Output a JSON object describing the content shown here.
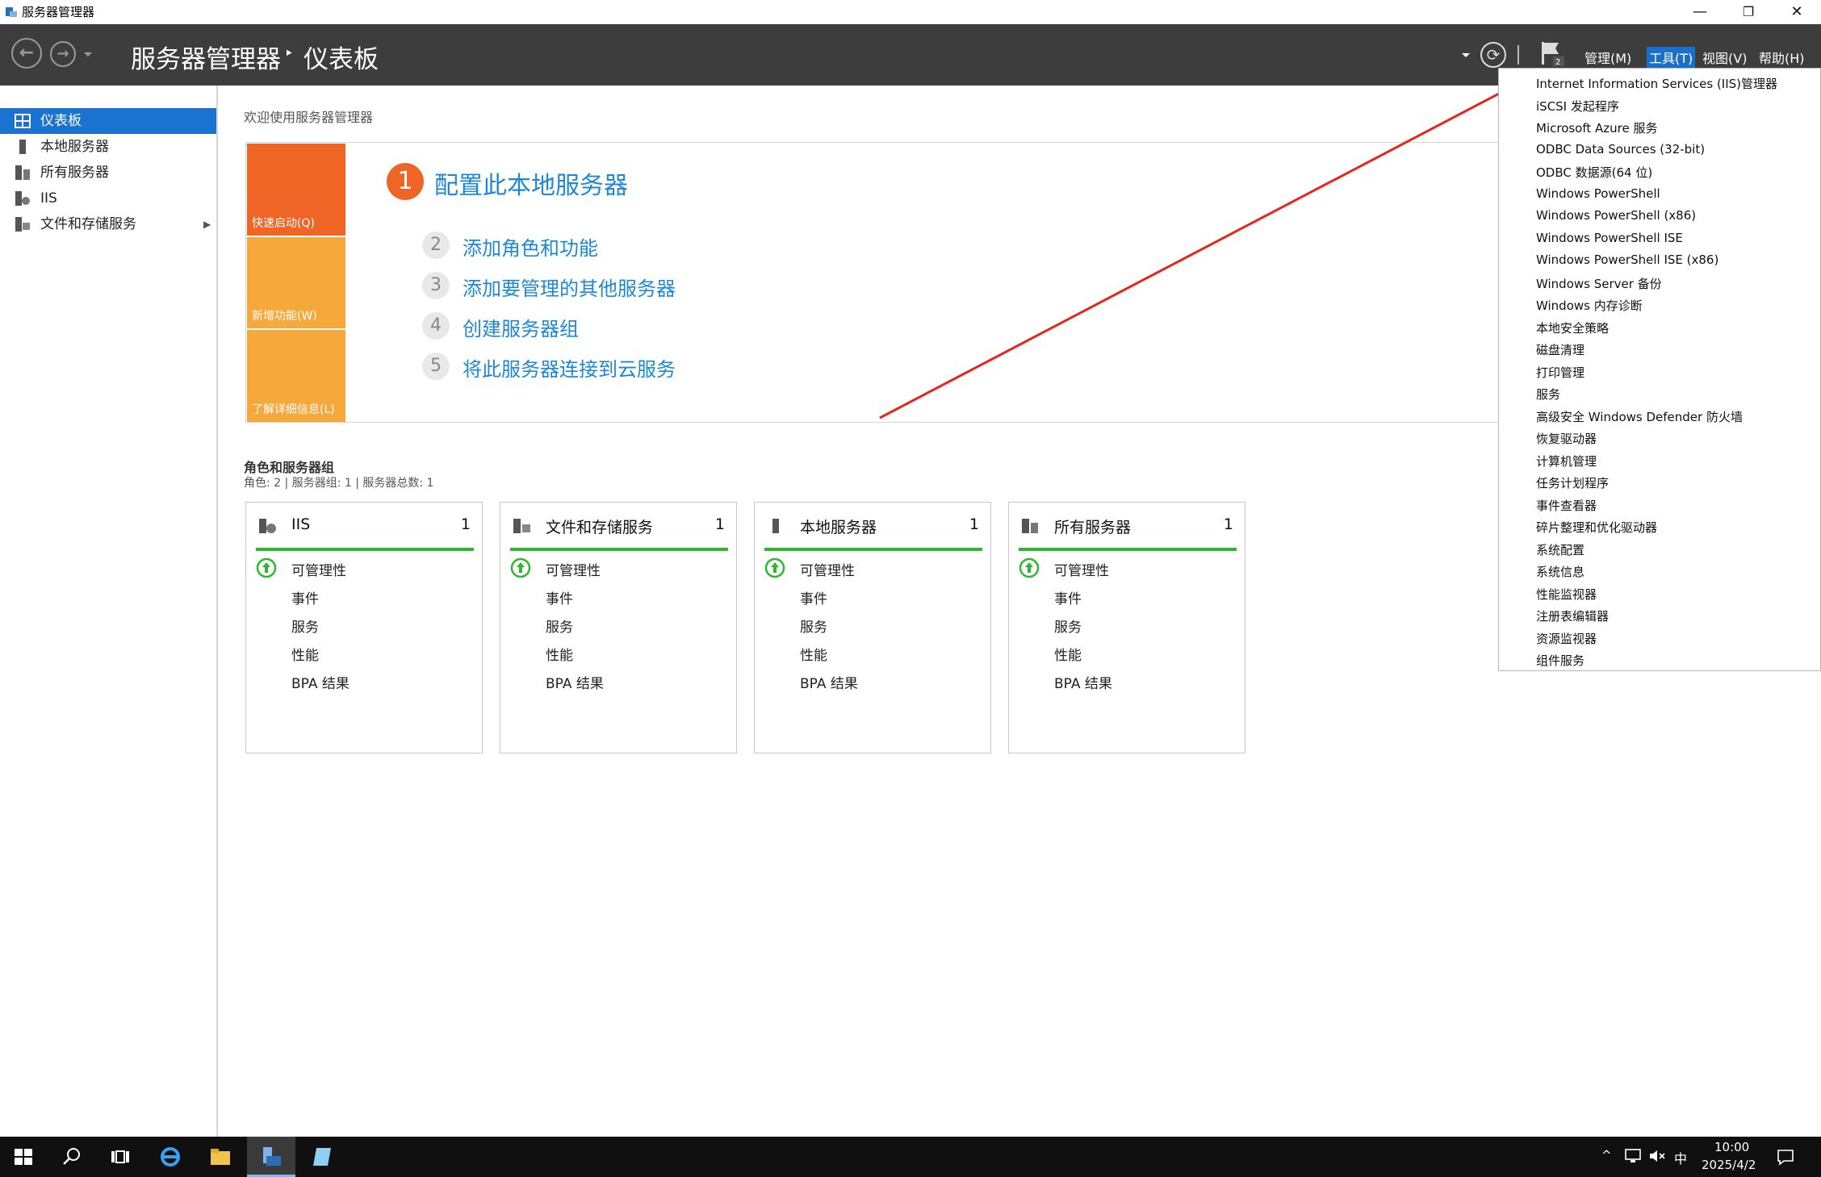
{
  "window": {
    "title": "服务器管理器",
    "controls": {
      "minimize": "—",
      "maximize": "❐",
      "close": "✕"
    }
  },
  "header": {
    "breadcrumb_root": "服务器管理器",
    "breadcrumb_sep": "‣",
    "breadcrumb_page": "仪表板",
    "back_icon": "←",
    "forward_icon": "→",
    "refresh_icon": "⟳",
    "menus": {
      "manage": "管理(M)",
      "tools": "工具(T)",
      "view": "视图(V)",
      "help": "帮助(H)"
    }
  },
  "sidebar": {
    "items": [
      {
        "label": "仪表板"
      },
      {
        "label": "本地服务器"
      },
      {
        "label": "所有服务器"
      },
      {
        "label": "IIS"
      },
      {
        "label": "文件和存储服务"
      }
    ],
    "expand_icon": "▶"
  },
  "main": {
    "welcome_title": "欢迎使用服务器管理器",
    "quickstart": {
      "tiles": [
        "快速启动(Q)",
        "新增功能(W)",
        "了解详细信息(L)"
      ],
      "steps": [
        {
          "num": "1",
          "text": "配置此本地服务器"
        },
        {
          "num": "2",
          "text": "添加角色和功能"
        },
        {
          "num": "3",
          "text": "添加要管理的其他服务器"
        },
        {
          "num": "4",
          "text": "创建服务器组"
        },
        {
          "num": "5",
          "text": "将此服务器连接到云服务"
        }
      ]
    },
    "roles_title": "角色和服务器组",
    "roles_summary": "角色: 2 | 服务器组: 1 | 服务器总数: 1",
    "cards": [
      {
        "title": "IIS",
        "count": "1",
        "rows": [
          "可管理性",
          "事件",
          "服务",
          "性能",
          "BPA 结果"
        ]
      },
      {
        "title": "文件和存储服务",
        "count": "1",
        "rows": [
          "可管理性",
          "事件",
          "服务",
          "性能",
          "BPA 结果"
        ]
      },
      {
        "title": "本地服务器",
        "count": "1",
        "rows": [
          "可管理性",
          "事件",
          "服务",
          "性能",
          "BPA 结果"
        ]
      },
      {
        "title": "所有服务器",
        "count": "1",
        "rows": [
          "可管理性",
          "事件",
          "服务",
          "性能",
          "BPA 结果"
        ]
      }
    ]
  },
  "tools_menu": {
    "items": [
      "Internet Information Services (IIS)管理器",
      "iSCSI 发起程序",
      "Microsoft Azure 服务",
      "ODBC Data Sources (32-bit)",
      "ODBC 数据源(64 位)",
      "Windows PowerShell",
      "Windows PowerShell (x86)",
      "Windows PowerShell ISE",
      "Windows PowerShell ISE (x86)",
      "Windows Server 备份",
      "Windows 内存诊断",
      "本地安全策略",
      "磁盘清理",
      "打印管理",
      "服务",
      "高级安全 Windows Defender 防火墙",
      "恢复驱动器",
      "计算机管理",
      "任务计划程序",
      "事件查看器",
      "碎片整理和优化驱动器",
      "系统配置",
      "系统信息",
      "性能监视器",
      "注册表编辑器",
      "资源监视器",
      "组件服务"
    ]
  },
  "taskbar": {
    "time": "10:00",
    "date": "2025/4/2",
    "ime": "中",
    "tray_up": "^"
  },
  "colors": {
    "header_bg": "#3d3d3d",
    "accent_blue": "#1a73d1",
    "quickstart_orange": "#ef6525",
    "tile_orange": "#f6a83a",
    "status_green": "#2eb82e",
    "annotation_red": "#e8241c"
  }
}
